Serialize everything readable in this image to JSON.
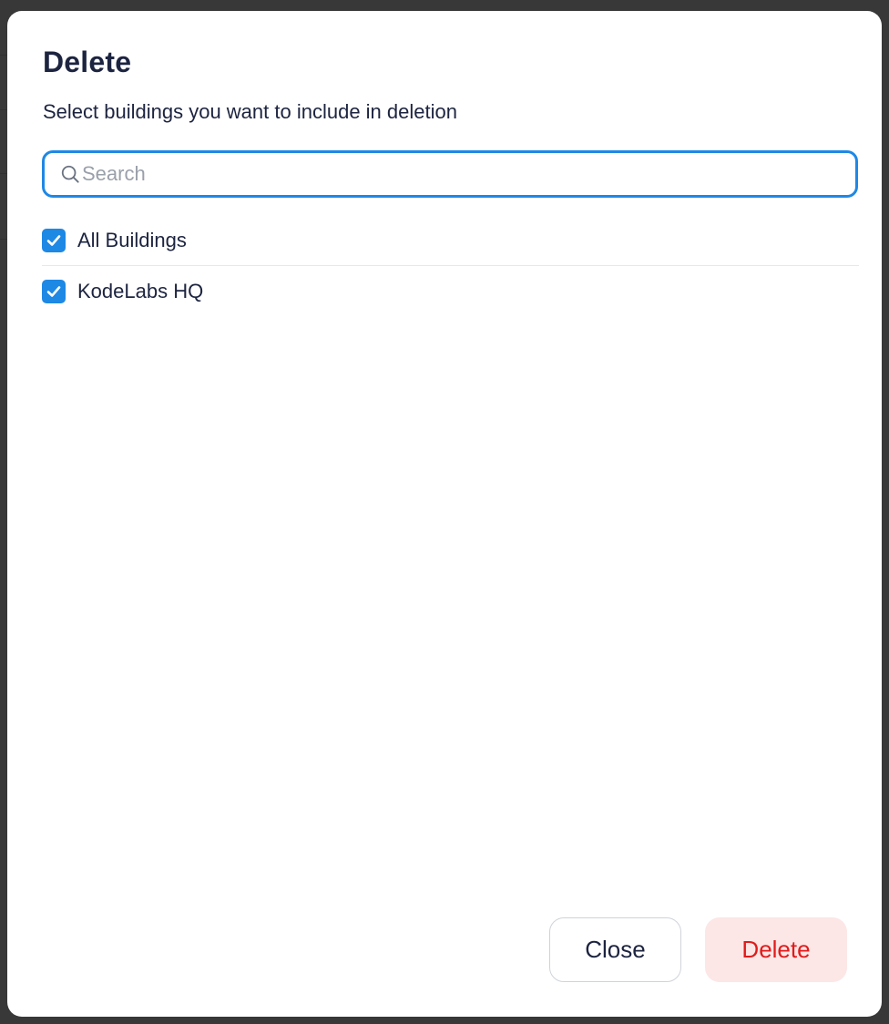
{
  "modal": {
    "title": "Delete",
    "subtitle": "Select buildings you want to include in deletion"
  },
  "search": {
    "placeholder": "Search",
    "value": "",
    "icon": "search-icon"
  },
  "buildings": [
    {
      "label": "All Buildings",
      "checked": true
    },
    {
      "label": "KodeLabs HQ",
      "checked": true
    }
  ],
  "actions": {
    "close_label": "Close",
    "delete_label": "Delete"
  },
  "colors": {
    "accent": "#1e88e5",
    "text": "#1d2440",
    "danger_text": "#e01b1b",
    "danger_bg": "#fce6e6"
  }
}
